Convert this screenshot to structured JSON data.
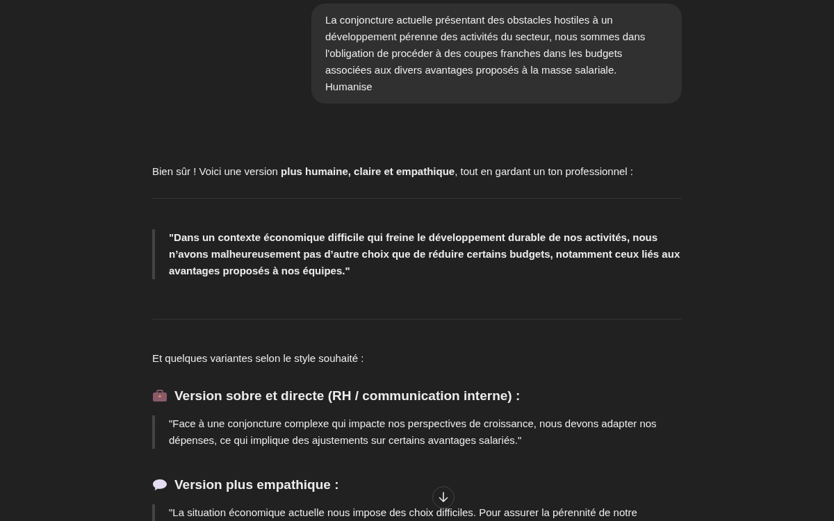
{
  "user_message": {
    "text": "La conjoncture actuelle présentant des obstacles hostiles à un développement pérenne des activités du secteur, nous sommes dans l'obligation de procéder à des coupes franches dans les budgets associées aux divers avantages proposés à la masse salariale.\nHumanise"
  },
  "response": {
    "blocks": [
      {
        "kind": "paragraph",
        "text": "Bien sûr ! Voici une version **plus humaine, claire et empathique**, tout en gardant un ton professionnel :"
      },
      {
        "kind": "divider"
      },
      {
        "kind": "quote",
        "bold": true,
        "text": "\"Dans un contexte économique difficile qui freine le développement durable de nos activités, nous n’avons malheureusement pas d’autre choix que de réduire certains budgets, notamment ceux liés aux avantages proposés à nos équipes.\""
      },
      {
        "kind": "divider"
      },
      {
        "kind": "paragraph",
        "text": "Et quelques variantes selon le style souhaité :"
      },
      {
        "kind": "heading",
        "text": "Version sobre et directe (RH / communication interne) :"
      },
      {
        "kind": "quote",
        "bold": false,
        "text": "\"Face à une conjoncture complexe qui impacte nos perspectives de croissance, nous devons adapter nos dépenses, ce qui implique des ajustements sur certains avantages salariés.\""
      },
      {
        "kind": "heading",
        "text": "Version plus empathique :"
      },
      {
        "kind": "quote",
        "bold": false,
        "text": "\"La situation économique actuelle nous impose des choix difficiles. Pour assurer la pérennité de notre"
      }
    ]
  },
  "scroll_button": {
    "kind": "down-arrow"
  }
}
